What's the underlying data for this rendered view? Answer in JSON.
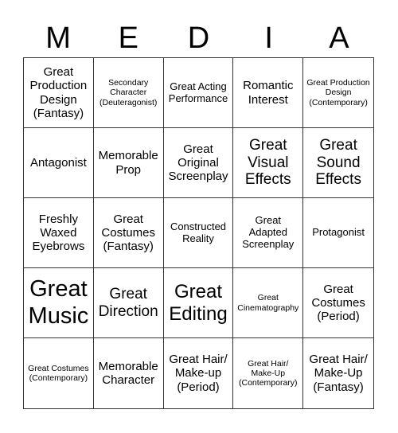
{
  "header": [
    "M",
    "E",
    "D",
    "I",
    "A"
  ],
  "cells": [
    {
      "text": "Great Production Design (Fantasy)",
      "size": "s3"
    },
    {
      "text": "Secondary Character (Deuteragonist)",
      "size": "s1"
    },
    {
      "text": "Great Acting Performance",
      "size": "s2"
    },
    {
      "text": "Romantic Interest",
      "size": "s3"
    },
    {
      "text": "Great Production Design (Contemporary)",
      "size": "s1"
    },
    {
      "text": "Antagonist",
      "size": "s3"
    },
    {
      "text": "Memorable Prop",
      "size": "s3"
    },
    {
      "text": "Great Original Screenplay",
      "size": "s3"
    },
    {
      "text": "Great Visual Effects",
      "size": "s4"
    },
    {
      "text": "Great Sound Effects",
      "size": "s4"
    },
    {
      "text": "Freshly Waxed Eyebrows",
      "size": "s3"
    },
    {
      "text": "Great Costumes (Fantasy)",
      "size": "s3"
    },
    {
      "text": "Constructed Reality",
      "size": "s2"
    },
    {
      "text": "Great Adapted Screenplay",
      "size": "s2"
    },
    {
      "text": "Protagonist",
      "size": "s2"
    },
    {
      "text": "Great Music",
      "size": "s6"
    },
    {
      "text": "Great Direction",
      "size": "s4"
    },
    {
      "text": "Great Editing",
      "size": "s5"
    },
    {
      "text": "Great Cinematography",
      "size": "s1"
    },
    {
      "text": "Great Costumes (Period)",
      "size": "s3"
    },
    {
      "text": "Great Costumes (Contemporary)",
      "size": "s1"
    },
    {
      "text": "Memorable Character",
      "size": "s3"
    },
    {
      "text": "Great Hair/ Make-up (Period)",
      "size": "s3"
    },
    {
      "text": "Great Hair/ Make-Up (Contemporary)",
      "size": "s1"
    },
    {
      "text": "Great Hair/ Make-Up (Fantasy)",
      "size": "s3"
    }
  ]
}
